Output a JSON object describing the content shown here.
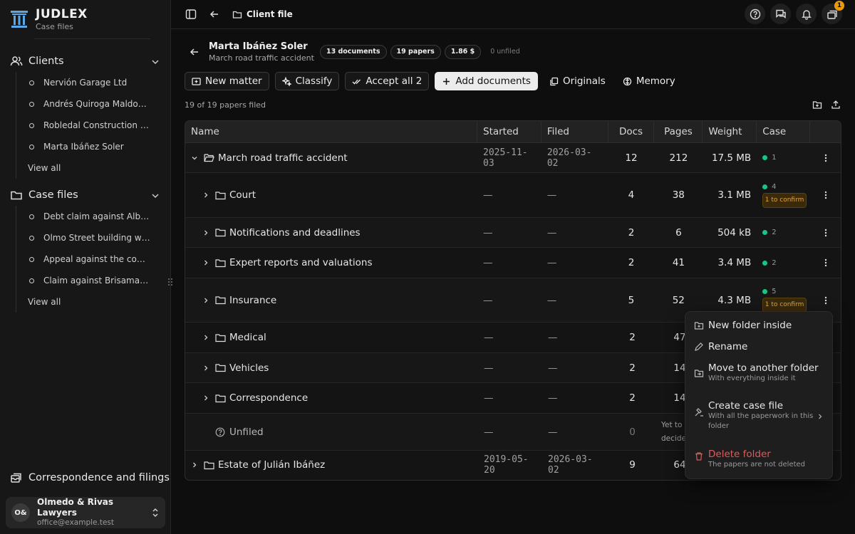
{
  "brand": {
    "name": "JUDLEX",
    "subtitle": "Case files"
  },
  "sidebar": {
    "clients": {
      "label": "Clients",
      "items": [
        "Nervión Garage Ltd",
        "Andrés Quiroga Maldona...",
        "Robledal Construction Ltd",
        "Marta Ibáñez Soler"
      ],
      "view_all": "View all"
    },
    "case_files": {
      "label": "Case files",
      "items": [
        "Debt claim against Albarr...",
        "Olmo Street building wor...",
        "Appeal against the const...",
        "Claim against Brisamar In..."
      ],
      "view_all": "View all"
    },
    "correspondence": "Correspondence and filings",
    "org": {
      "initials": "O&",
      "name": "Olmedo & Rivas Lawyers",
      "email": "office@example.test"
    }
  },
  "topbar": {
    "breadcrumb": "Client file",
    "notification_count": "1"
  },
  "header": {
    "name": "Marta Ibáñez Soler",
    "subtitle": "March road traffic accident",
    "pills": [
      "13 documents",
      "19 papers",
      "1.86 $"
    ],
    "unfiled": "0 unfiled"
  },
  "actions": {
    "new_matter": "New matter",
    "classify": "Classify",
    "accept_all": "Accept all 2",
    "add_documents": "Add documents",
    "originals": "Originals",
    "memory": "Memory"
  },
  "filed_text": "19 of 19 papers filed",
  "table": {
    "headers": [
      "Name",
      "Started",
      "Filed",
      "Docs",
      "Pages",
      "Weight",
      "Case"
    ],
    "rows": [
      {
        "name": "March road traffic accident",
        "started": "2025-11-03",
        "filed": "2026-03-02",
        "docs": "12",
        "pages": "212",
        "weight": "17.5 MB",
        "case": "1",
        "confirm": ""
      },
      {
        "name": "Court",
        "started": "—",
        "filed": "—",
        "docs": "4",
        "pages": "38",
        "weight": "3.1 MB",
        "case": "4",
        "confirm": "1 to confirm"
      },
      {
        "name": "Notifications and deadlines",
        "started": "—",
        "filed": "—",
        "docs": "2",
        "pages": "6",
        "weight": "504 kB",
        "case": "2",
        "confirm": ""
      },
      {
        "name": "Expert reports and valuations",
        "started": "—",
        "filed": "—",
        "docs": "2",
        "pages": "41",
        "weight": "3.4 MB",
        "case": "2",
        "confirm": ""
      },
      {
        "name": "Insurance",
        "started": "—",
        "filed": "—",
        "docs": "5",
        "pages": "52",
        "weight": "4.3 MB",
        "case": "5",
        "confirm": "1 to confirm"
      },
      {
        "name": "Medical",
        "started": "—",
        "filed": "—",
        "docs": "2",
        "pages": "47",
        "weight": "",
        "case": "",
        "confirm": ""
      },
      {
        "name": "Vehicles",
        "started": "—",
        "filed": "—",
        "docs": "2",
        "pages": "14",
        "weight": "",
        "case": "",
        "confirm": ""
      },
      {
        "name": "Correspondence",
        "started": "—",
        "filed": "—",
        "docs": "2",
        "pages": "14",
        "weight": "",
        "case": "",
        "confirm": ""
      },
      {
        "name": "Unfiled",
        "started": "—",
        "filed": "—",
        "docs": "0",
        "pages": "Yet to decide",
        "weight": "",
        "case": "",
        "confirm": ""
      },
      {
        "name": "Estate of Julián Ibáñez",
        "started": "2019-05-20",
        "filed": "2026-03-02",
        "docs": "9",
        "pages": "64",
        "weight": "",
        "case": "",
        "confirm": ""
      }
    ]
  },
  "context_menu": {
    "new_folder": "New folder inside",
    "rename": "Rename",
    "move": "Move to another folder",
    "move_desc": "With everything inside it",
    "create_case": "Create case file",
    "create_case_desc": "With all the paperwork in this folder",
    "delete": "Delete folder",
    "delete_desc": "The papers are not deleted"
  },
  "colors": {
    "accent_green": "#16c784",
    "warning": "#e3a53a",
    "danger": "#e05a5a",
    "badge": "#e89a0c"
  }
}
